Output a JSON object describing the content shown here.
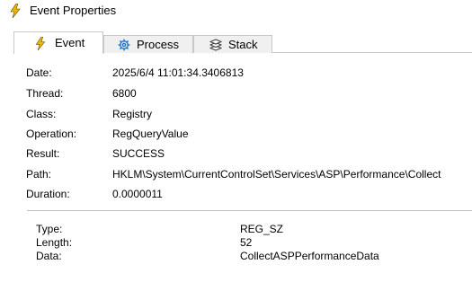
{
  "window": {
    "title": "Event Properties",
    "title_icon": "lightning-icon"
  },
  "tabs": [
    {
      "label": "Event",
      "icon": "lightning-icon",
      "active": true
    },
    {
      "label": "Process",
      "icon": "gear-icon",
      "active": false
    },
    {
      "label": "Stack",
      "icon": "layers-icon",
      "active": false
    }
  ],
  "event": {
    "date_label": "Date:",
    "date": "2025/6/4 11:01:34.3406813",
    "thread_label": "Thread:",
    "thread": "6800",
    "class_label": "Class:",
    "class": "Registry",
    "operation_label": "Operation:",
    "operation": "RegQueryValue",
    "result_label": "Result:",
    "result": "SUCCESS",
    "path_label": "Path:",
    "path": "HKLM\\System\\CurrentControlSet\\Services\\ASP\\Performance\\Collect",
    "duration_label": "Duration:",
    "duration": "0.0000011"
  },
  "details": {
    "type_label": "Type:",
    "type": "REG_SZ",
    "length_label": "Length:",
    "length": "52",
    "data_label": "Data:",
    "data": "CollectASPPerformanceData"
  },
  "colors": {
    "lightning": "#f2b600",
    "gear": "#1a73c8",
    "stack": "#404040"
  }
}
